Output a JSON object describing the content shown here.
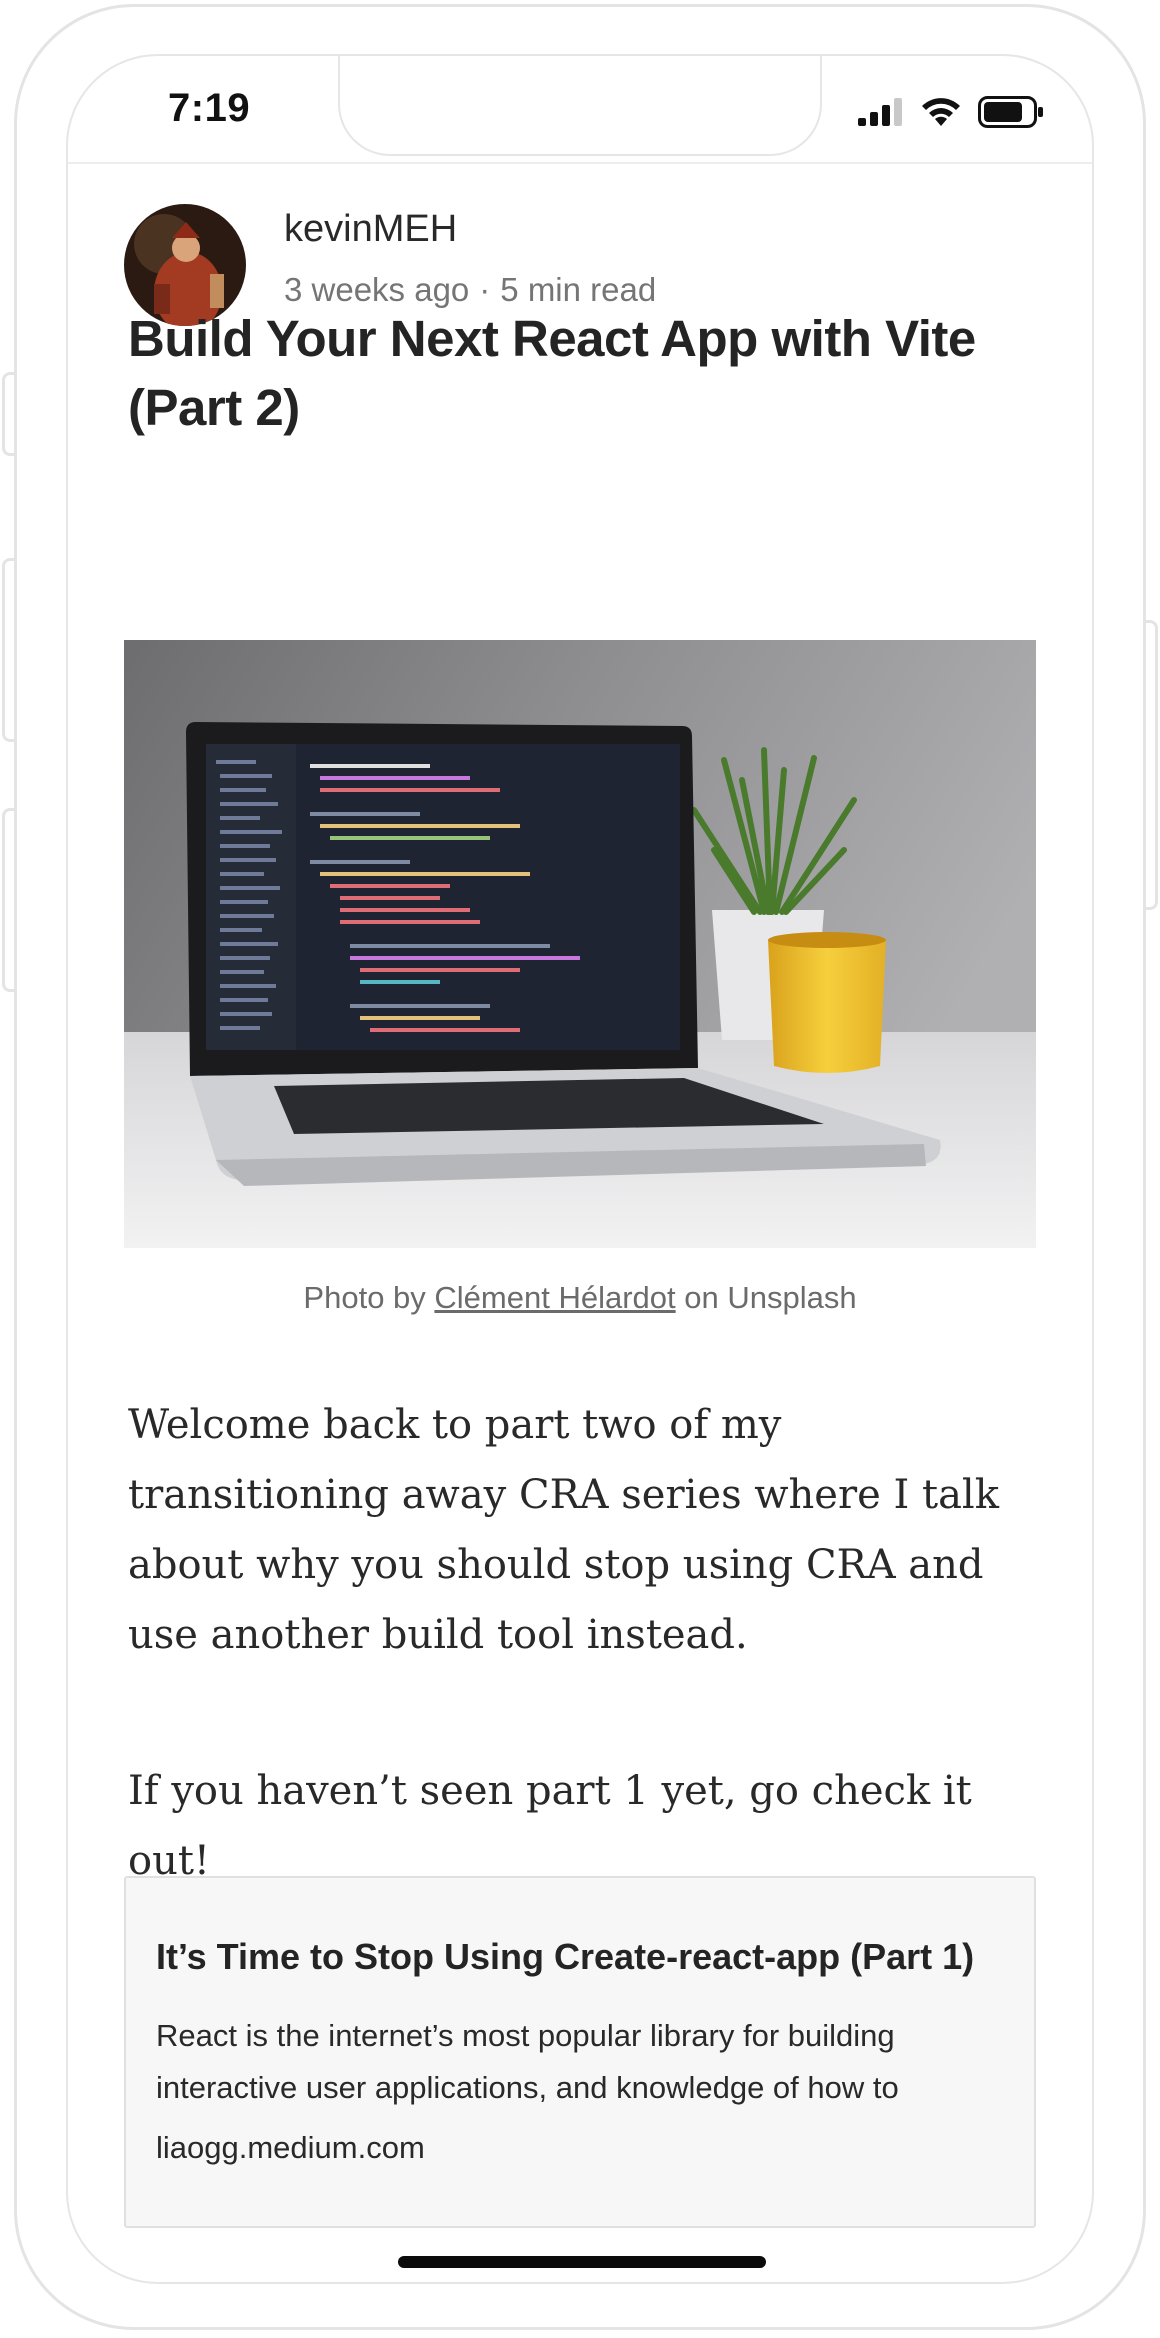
{
  "status_bar": {
    "time": "7:19",
    "signal_icon": "cellular-signal-icon",
    "wifi_icon": "wifi-icon",
    "battery_icon": "battery-icon"
  },
  "article": {
    "author": "kevinMEH",
    "published": "3 weeks ago",
    "separator": "·",
    "read_time": "5 min read",
    "title": "Build Your Next React App with Vite (Part 2)",
    "hero_image_alt": "Laptop with code editor on a desk next to a plant and a yellow mug",
    "caption_prefix": "Photo by ",
    "caption_author": "Clément Hélardot",
    "caption_suffix": " on Unsplash",
    "paragraphs": [
      "Welcome back to part two of my transitioning away CRA series where I talk about why you should stop using CRA and use another build tool instead.",
      "If you haven’t seen part 1 yet, go check it out!"
    ],
    "link_card": {
      "title": "It’s Time to Stop Using Create-react-app (Part 1)",
      "description": "React is the internet’s most popular library for building interactive user applications, and knowledge of how to",
      "domain": "liaogg.medium.com"
    }
  },
  "colors": {
    "text_primary": "#242424",
    "text_secondary": "#757575",
    "card_background": "#f7f7f7",
    "mug_yellow": "#f2c230"
  }
}
